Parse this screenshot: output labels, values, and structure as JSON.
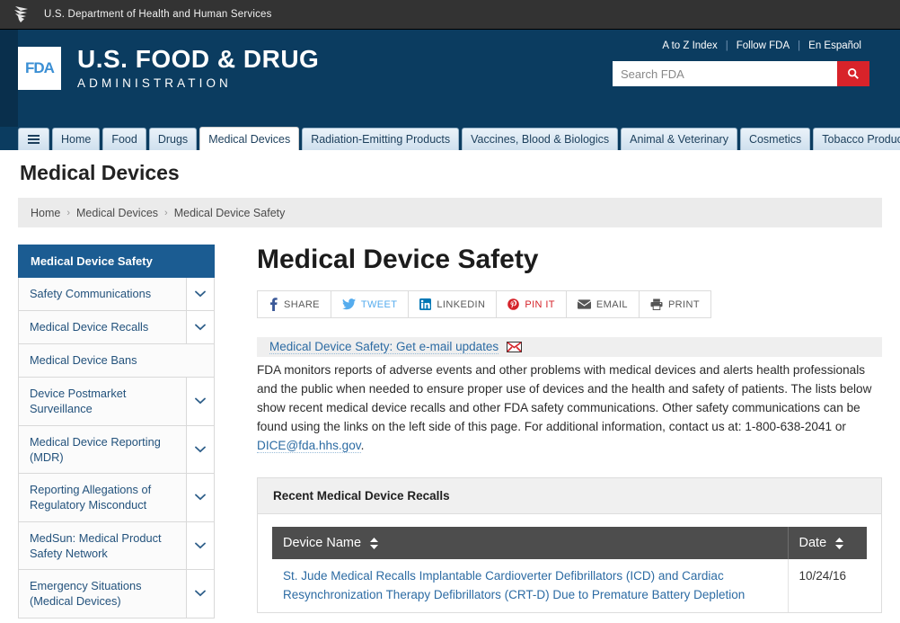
{
  "hhs": {
    "logo_icon": "hhs-eagle-logo",
    "text": "U.S. Department of Health and Human Services"
  },
  "brand": {
    "logo_text": "FDA",
    "title": "U.S. FOOD & DRUG",
    "subtitle": "ADMINISTRATION"
  },
  "utility_links": [
    {
      "label": "A to Z Index"
    },
    {
      "label": "Follow FDA"
    },
    {
      "label": "En Español"
    }
  ],
  "search": {
    "placeholder": "Search FDA",
    "value": "",
    "button_icon": "search-icon"
  },
  "nav": {
    "menu_icon": "hamburger-menu-icon",
    "tabs": [
      {
        "label": "Home",
        "active": false
      },
      {
        "label": "Food",
        "active": false
      },
      {
        "label": "Drugs",
        "active": false
      },
      {
        "label": "Medical Devices",
        "active": true
      },
      {
        "label": "Radiation-Emitting Products",
        "active": false
      },
      {
        "label": "Vaccines, Blood & Biologics",
        "active": false
      },
      {
        "label": "Animal & Veterinary",
        "active": false
      },
      {
        "label": "Cosmetics",
        "active": false
      },
      {
        "label": "Tobacco Products",
        "active": false
      }
    ]
  },
  "page": {
    "section_title": "Medical Devices",
    "heading": "Medical Device Safety"
  },
  "breadcrumb": [
    {
      "label": "Home"
    },
    {
      "label": "Medical Devices"
    },
    {
      "label": "Medical Device Safety"
    }
  ],
  "sidebar": {
    "header": "Medical Device Safety",
    "items": [
      {
        "label": "Safety Communications",
        "expandable": true
      },
      {
        "label": "Medical Device Recalls",
        "expandable": true
      },
      {
        "label": "Medical Device Bans",
        "expandable": false
      },
      {
        "label": "Device Postmarket Surveillance",
        "expandable": true
      },
      {
        "label": "Medical Device Reporting (MDR)",
        "expandable": true
      },
      {
        "label": "Reporting Allegations of Regulatory Misconduct",
        "expandable": true
      },
      {
        "label": "MedSun: Medical Product Safety Network",
        "expandable": true
      },
      {
        "label": "Emergency Situations (Medical Devices)",
        "expandable": true
      }
    ]
  },
  "share_buttons": [
    {
      "label": "SHARE",
      "icon": "facebook-icon",
      "color": "#3b5998"
    },
    {
      "label": "TWEET",
      "icon": "twitter-icon",
      "color": "#55acee"
    },
    {
      "label": "LINKEDIN",
      "icon": "linkedin-icon",
      "color": "#0077b5"
    },
    {
      "label": "PIN IT",
      "icon": "pinterest-icon",
      "color": "#d5232a"
    },
    {
      "label": "EMAIL",
      "icon": "envelope-icon",
      "color": "#555555"
    },
    {
      "label": "PRINT",
      "icon": "printer-icon",
      "color": "#555555"
    }
  ],
  "email_updates": {
    "label": "Medical Device Safety: Get e-mail updates",
    "icon": "email-envelope-icon"
  },
  "intro": {
    "part1": "FDA monitors reports of adverse events and other problems with medical devices and alerts health professionals and the public when needed to ensure proper use of devices and the health and safety of patients.  The lists below show recent medical device recalls and other FDA safety communications. Other safety communications can be found using the links on the left side of this page. For additional information, contact us at:  1-800-638-2041 or ",
    "email_link": "DICE@fda.hhs.gov",
    "part2": "."
  },
  "recalls_panel": {
    "title": "Recent Medical Device Recalls",
    "columns": [
      {
        "label": "Device Name",
        "sortable": true
      },
      {
        "label": "Date",
        "sortable": true
      }
    ],
    "rows": [
      {
        "device_name": "St. Jude Medical Recalls Implantable Cardioverter Defibrillators (ICD) and Cardiac Resynchronization Therapy Defibrillators (CRT-D) Due to Premature Battery Depletion",
        "date": "10/24/16"
      }
    ]
  },
  "colors": {
    "hhs_bar": "#333333",
    "fda_blue": "#0b3c60",
    "search_red": "#d8232a",
    "sidebar_active": "#1b5c92",
    "link_blue": "#2c6ba3",
    "table_header": "#4d4d4d"
  }
}
